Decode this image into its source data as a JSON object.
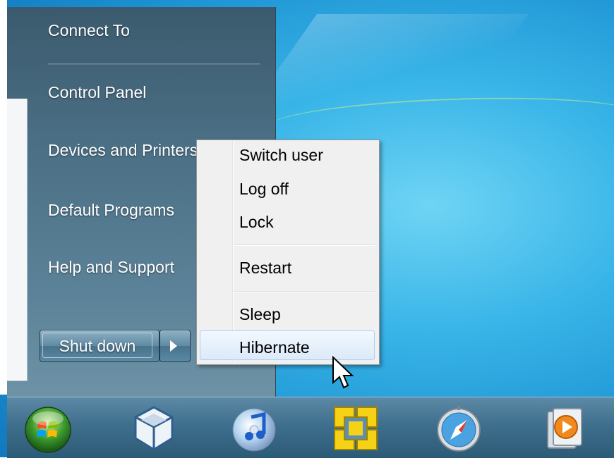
{
  "start_menu": {
    "items": [
      "Connect To",
      "Control Panel",
      "Devices and Printers",
      "Default Programs",
      "Help and Support"
    ],
    "shutdown_label": "Shut down"
  },
  "power_menu": {
    "items": [
      "Switch user",
      "Log off",
      "Lock",
      "Restart",
      "Sleep",
      "Hibernate"
    ],
    "highlighted": "Hibernate"
  },
  "taskbar": {
    "icons": [
      "start-orb",
      "virtualbox",
      "itunes",
      "vmware",
      "safari",
      "media-player"
    ]
  },
  "colors": {
    "desktop_blue": "#39b5e8",
    "start_menu_bg": "#4d7288",
    "taskbar_bg": "#3e6f8c",
    "popup_bg": "#f0f0f0",
    "highlight": "#dceaf9"
  }
}
